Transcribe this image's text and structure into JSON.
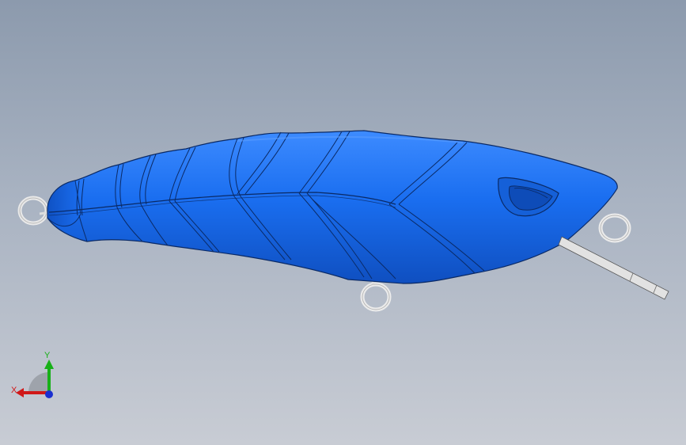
{
  "viewport": {
    "background_top": "#8c9aad",
    "background_bottom": "#c8ccd4"
  },
  "model": {
    "body_color": "#1a6ef0",
    "body_dark": "#0f4fc0",
    "body_light": "#3d8bff",
    "edge_color": "#0a2a66",
    "ring_color": "#e9e9e9",
    "wire_color": "#d8d8d8"
  },
  "triad": {
    "x_label": "X",
    "y_label": "Y",
    "x_color": "#d01818",
    "y_color": "#18b018",
    "z_color": "#1a2fd0"
  }
}
